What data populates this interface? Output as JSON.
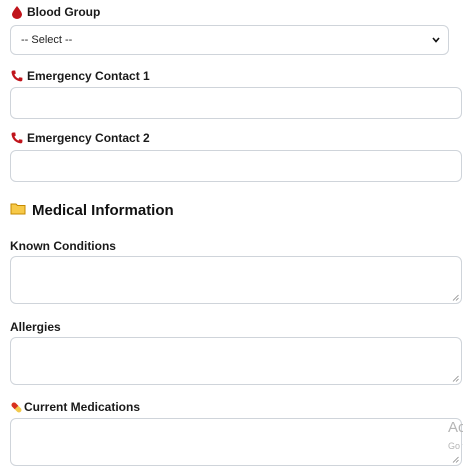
{
  "fields": {
    "blood_group": {
      "label": "Blood Group",
      "icon": "blood-drop-icon",
      "selected": "-- Select --"
    },
    "emergency_contact_1": {
      "label": "Emergency Contact 1",
      "icon": "phone-icon",
      "value": ""
    },
    "emergency_contact_2": {
      "label": "Emergency Contact 2",
      "icon": "phone-icon",
      "value": ""
    }
  },
  "medical": {
    "title": "Medical Information",
    "icon": "folder-icon",
    "known_conditions": {
      "label": "Known Conditions",
      "value": ""
    },
    "allergies": {
      "label": "Allergies",
      "value": ""
    },
    "current_medications": {
      "label": "Current Medications",
      "icon": "pill-icon",
      "value": ""
    }
  },
  "watermark": {
    "line1": "Act",
    "line2": "Go t"
  },
  "colors": {
    "blood": "#c0141b",
    "phone": "#c0141b",
    "folder": "#f2b705",
    "border": "#cfd4da"
  }
}
